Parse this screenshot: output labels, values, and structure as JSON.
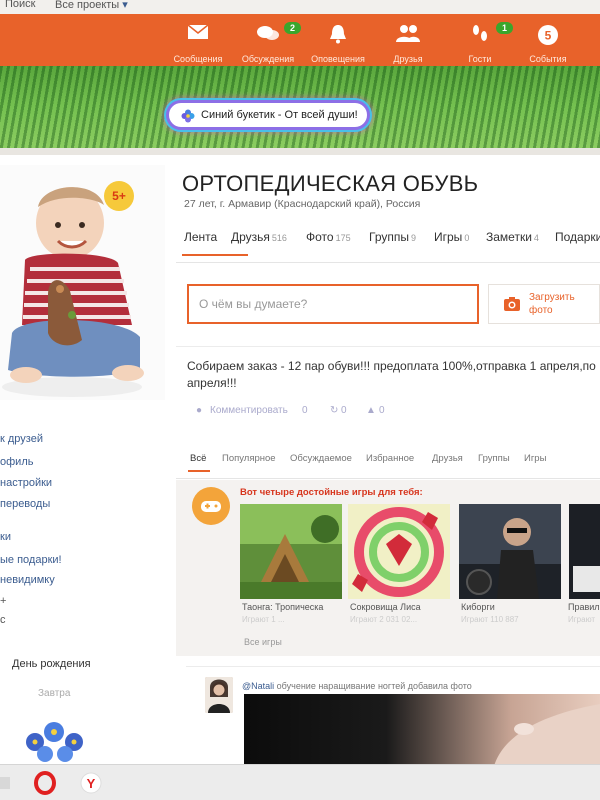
{
  "topbar": {
    "search": "Поиск",
    "projects": "Все проекты"
  },
  "nav": [
    {
      "label": "Сообщения",
      "icon": "envelope-icon",
      "badge": ""
    },
    {
      "label": "Обсуждения",
      "icon": "speech-bubbles-icon",
      "badge": "2"
    },
    {
      "label": "Оповещения",
      "icon": "bell-icon",
      "badge": ""
    },
    {
      "label": "Друзья",
      "icon": "friends-icon",
      "badge": ""
    },
    {
      "label": "Гости",
      "icon": "footprints-icon",
      "badge": "1"
    },
    {
      "label": "События",
      "icon": "events-icon",
      "badge": ""
    }
  ],
  "gift": {
    "text": "Синий букетик - От всей души!"
  },
  "profile": {
    "age_badge": "5+",
    "name": "ОРТОПЕДИЧЕСКАЯ ОБУВЬ",
    "location": "27 лет, г. Армавир (Краснодарский край), Россия",
    "tabs": [
      {
        "label": "Лента",
        "count": ""
      },
      {
        "label": "Друзья",
        "count": "516"
      },
      {
        "label": "Фото",
        "count": "175"
      },
      {
        "label": "Группы",
        "count": "9"
      },
      {
        "label": "Игры",
        "count": "0"
      },
      {
        "label": "Заметки",
        "count": "4"
      },
      {
        "label": "Подарки",
        "count": ""
      }
    ]
  },
  "left_links": [
    {
      "text": "к друзей",
      "style": "link"
    },
    {
      "text": "офиль",
      "style": "link"
    },
    {
      "text": "настройки",
      "style": "link"
    },
    {
      "text": "переводы",
      "style": "link"
    },
    {
      "text": "ки",
      "style": "link"
    },
    {
      "text": "ые подарки!",
      "style": "link"
    },
    {
      "text": "невидимку",
      "style": "link"
    },
    {
      "text": "+",
      "style": "plain"
    },
    {
      "text": "с",
      "style": "plain"
    }
  ],
  "birthday": {
    "label": "День рождения",
    "sub": "Завтра"
  },
  "post_box": {
    "placeholder": "О чём вы думаете?",
    "upload_label": "Загрузить фото"
  },
  "status": {
    "text": "Собираем заказ - 12 пар обуви!!! предоплата 100%,отправка 1 апреля,по апреля!!!",
    "comment_label": "Комментировать",
    "comments": "0",
    "shares": "0",
    "likes": "0"
  },
  "feed_tabs": [
    "Всё",
    "Популярное",
    "Обсуждаемое",
    "Избранное",
    "Друзья",
    "Группы",
    "Игры"
  ],
  "games": {
    "title": "Вот четыре достойные игры для тебя:",
    "items": [
      {
        "name": "Таонга: Тропическа",
        "meta": "Играют 1 ..."
      },
      {
        "name": "Сокровища Лиса",
        "meta": "Играют 2 031 02..."
      },
      {
        "name": "Киборги",
        "meta": "Играют 110 887"
      },
      {
        "name": "Правил",
        "meta": "Играют"
      }
    ],
    "all_games": "Все игры"
  },
  "user_post": {
    "author": "@Natali",
    "action": "обучение наращивание ногтей",
    "suffix": "добавила фото"
  },
  "colors": {
    "accent": "#e8622a",
    "link": "#3b5c8f",
    "badge": "#3aa62c"
  }
}
